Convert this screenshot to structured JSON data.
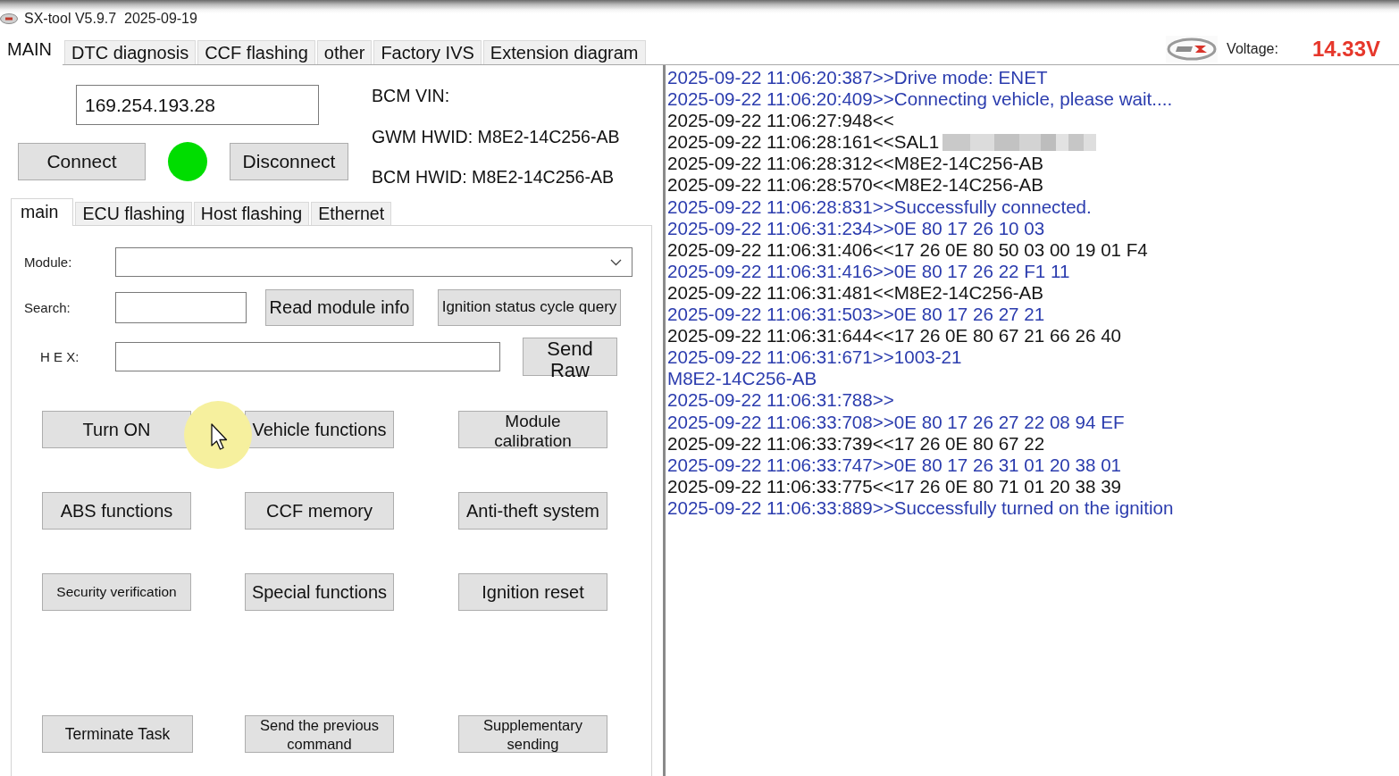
{
  "window": {
    "title": "SX-tool V5.9.7  2025-09-19"
  },
  "tabs": [
    {
      "label": "MAIN",
      "selected": true
    },
    {
      "label": "DTC diagnosis",
      "selected": false
    },
    {
      "label": "CCF flashing",
      "selected": false
    },
    {
      "label": "other",
      "selected": false
    },
    {
      "label": "Factory IVS",
      "selected": false
    },
    {
      "label": "Extension diagram",
      "selected": false
    }
  ],
  "voltage": {
    "label": "Voltage:",
    "value": "14.33V"
  },
  "connection": {
    "ip_address": "169.254.193.28",
    "connect_button": "Connect",
    "connected": true,
    "disconnect_button": "Disconnect"
  },
  "vehicle_info": [
    "BCM VIN:",
    "GWM HWID: M8E2-14C256-AB",
    "BCM HWID: M8E2-14C256-AB"
  ],
  "sub_tabs": [
    {
      "label": "main",
      "selected": true
    },
    {
      "label": "ECU flashing",
      "selected": false
    },
    {
      "label": "Host flashing",
      "selected": false
    },
    {
      "label": "Ethernet",
      "selected": false
    }
  ],
  "module_panel": {
    "module_label": "Module:",
    "search_label": "Search:",
    "read_button": "Read module info",
    "ignition_query_button": "Ignition status cycle query",
    "hex_label": "H E X:",
    "send_raw_button": "Send Raw",
    "function_buttons": [
      "Turn ON",
      "Vehicle functions",
      "Module calibration",
      "ABS functions",
      "CCF memory",
      "Anti-theft system",
      "Security verification",
      "Special functions",
      "Ignition reset"
    ],
    "task_buttons": [
      "Terminate Task",
      "Send the previous command",
      "Supplementary sending"
    ]
  },
  "log": [
    {
      "text": "2025-09-22 11:06:20:387>>Drive mode: ENET",
      "kind": "sent",
      "redacted": false
    },
    {
      "text": "2025-09-22 11:06:20:409>>Connecting vehicle, please wait....",
      "kind": "sent",
      "redacted": false
    },
    {
      "text": "2025-09-22 11:06:27:948<<",
      "kind": "received",
      "redacted": false
    },
    {
      "text": "2025-09-22 11:06:28:161<<SAL1",
      "kind": "received",
      "redacted": true
    },
    {
      "text": "2025-09-22 11:06:28:312<<M8E2-14C256-AB",
      "kind": "received",
      "redacted": false
    },
    {
      "text": "2025-09-22 11:06:28:570<<M8E2-14C256-AB",
      "kind": "received",
      "redacted": false
    },
    {
      "text": "2025-09-22 11:06:28:831>>Successfully connected.",
      "kind": "sent",
      "redacted": false
    },
    {
      "text": "2025-09-22 11:06:31:234>>0E 80 17 26 10 03",
      "kind": "sent",
      "redacted": false
    },
    {
      "text": "2025-09-22 11:06:31:406<<17 26 0E 80 50 03 00 19 01 F4",
      "kind": "received",
      "redacted": false
    },
    {
      "text": "2025-09-22 11:06:31:416>>0E 80 17 26 22 F1 11",
      "kind": "sent",
      "redacted": false
    },
    {
      "text": "2025-09-22 11:06:31:481<<M8E2-14C256-AB",
      "kind": "received",
      "redacted": false
    },
    {
      "text": "2025-09-22 11:06:31:503>>0E 80 17 26 27 21",
      "kind": "sent",
      "redacted": false
    },
    {
      "text": "2025-09-22 11:06:31:644<<17 26 0E 80 67 21 66 26 40",
      "kind": "received",
      "redacted": false
    },
    {
      "text": "2025-09-22 11:06:31:671>>1003-21",
      "kind": "sent",
      "redacted": false
    },
    {
      "text": "M8E2-14C256-AB",
      "kind": "sent",
      "redacted": false
    },
    {
      "text": "2025-09-22 11:06:31:788>>",
      "kind": "sent",
      "redacted": false
    },
    {
      "text": "2025-09-22 11:06:33:708>>0E 80 17 26 27 22 08 94 EF",
      "kind": "sent",
      "redacted": false
    },
    {
      "text": "2025-09-22 11:06:33:739<<17 26 0E 80 67 22",
      "kind": "received",
      "redacted": false
    },
    {
      "text": "2025-09-22 11:06:33:747>>0E 80 17 26 31 01 20 38 01",
      "kind": "sent",
      "redacted": false
    },
    {
      "text": "2025-09-22 11:06:33:775<<17 26 0E 80 71 01 20 38 39",
      "kind": "received",
      "redacted": false
    },
    {
      "text": "2025-09-22 11:06:33:889>>Successfully turned on the ignition",
      "kind": "sent",
      "redacted": false
    }
  ]
}
